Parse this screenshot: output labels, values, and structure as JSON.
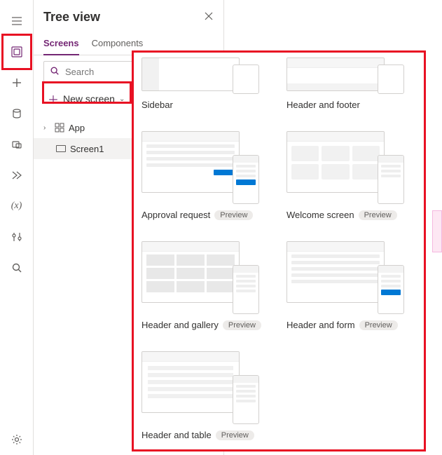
{
  "panel": {
    "title": "Tree view",
    "tabs": {
      "screens": "Screens",
      "components": "Components"
    },
    "search_placeholder": "Search",
    "new_screen_label": "New screen",
    "tree": {
      "app": "App",
      "screen1": "Screen1"
    }
  },
  "templates": {
    "sidebar": "Sidebar",
    "header_footer": "Header and footer",
    "approval_request": "Approval request",
    "welcome_screen": "Welcome screen",
    "header_gallery": "Header and gallery",
    "header_form": "Header and form",
    "header_table": "Header and table",
    "preview_badge": "Preview"
  },
  "rail_icons": [
    "hamburger",
    "tree-view",
    "insert",
    "data",
    "media",
    "power-automate",
    "variables",
    "tools",
    "search",
    "settings"
  ]
}
